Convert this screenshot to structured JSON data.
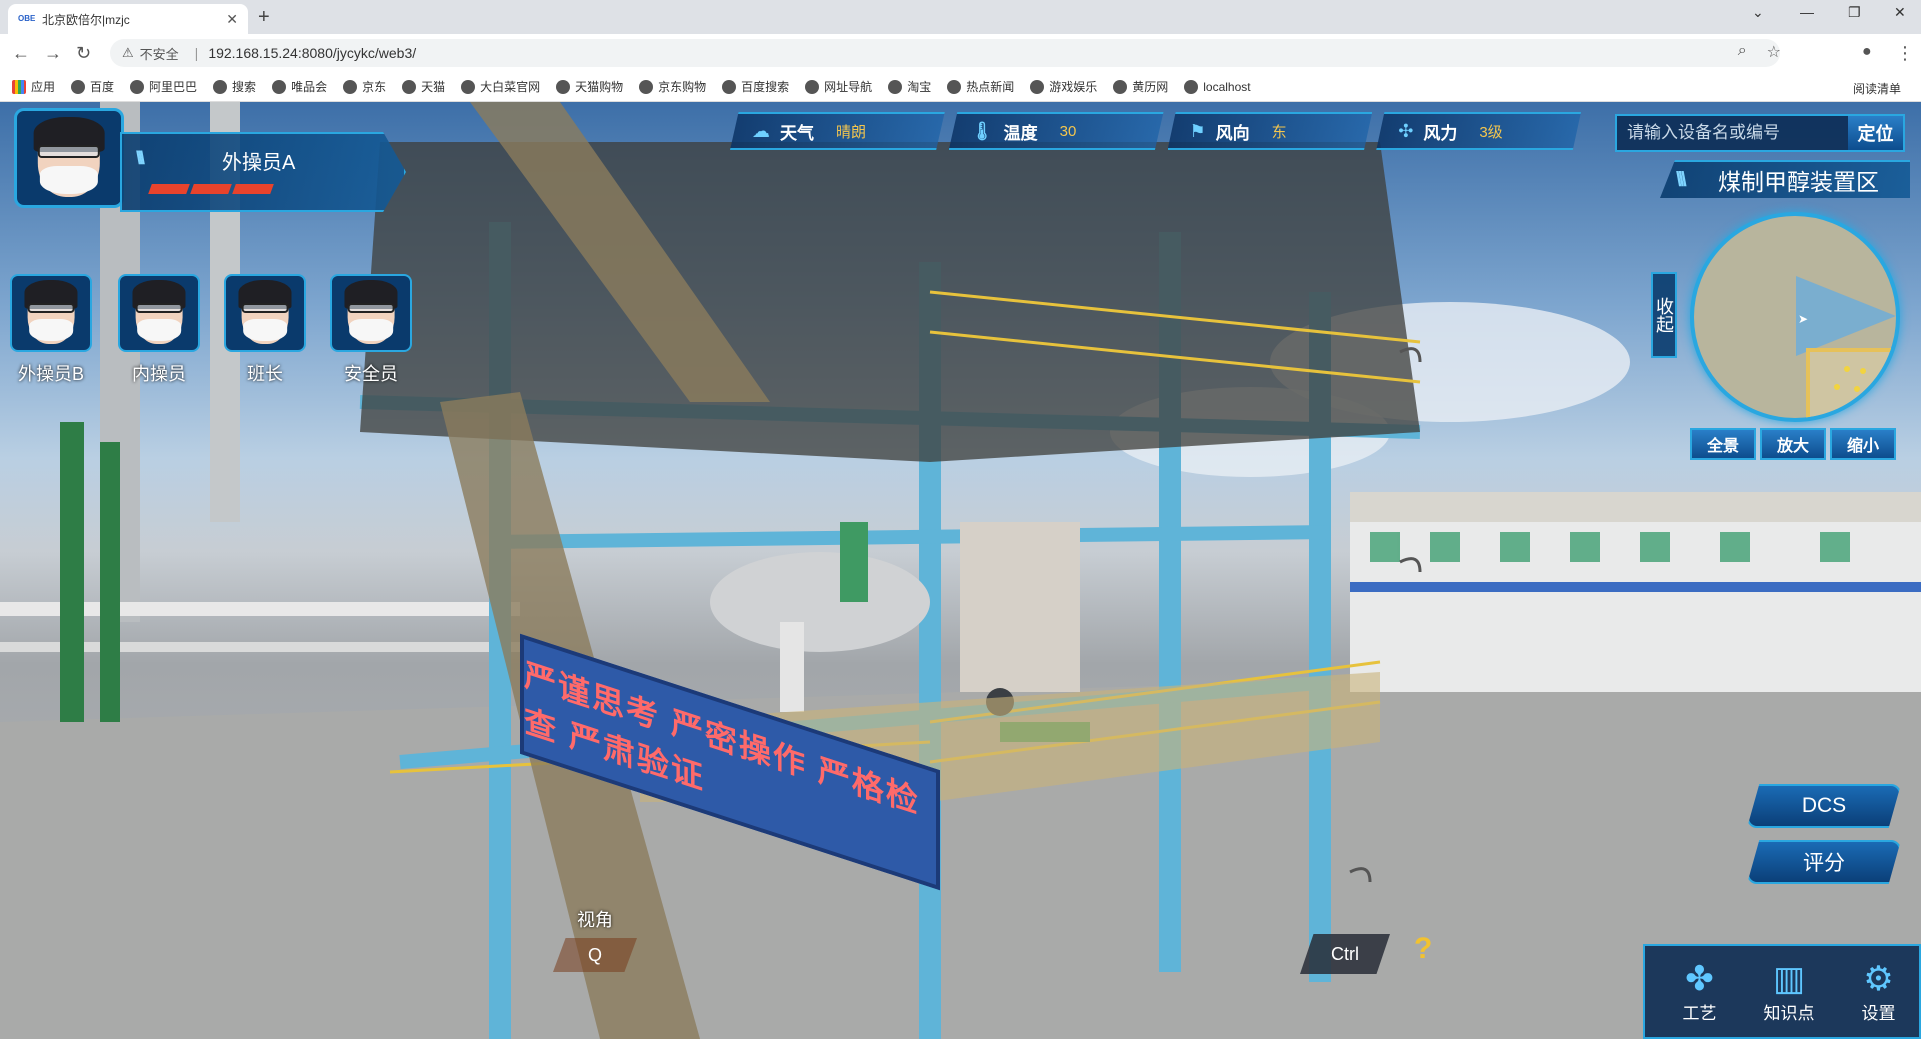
{
  "browser": {
    "tab_title": "北京欧倍尔|mzjc",
    "favicon_text": "OBE",
    "address_warning": "不安全",
    "url": "192.168.15.24:8080/jycykc/web3/",
    "bookmarks": [
      "应用",
      "百度",
      "阿里巴巴",
      "搜索",
      "唯品会",
      "京东",
      "天猫",
      "大白菜官网",
      "天猫购物",
      "京东购物",
      "百度搜索",
      "网址导航",
      "淘宝",
      "热点新闻",
      "游戏娱乐",
      "黄历网",
      "localhost"
    ],
    "reading_list": "阅读清单"
  },
  "hud": {
    "main_role": "外操员A",
    "roles": [
      "外操员B",
      "内操员",
      "班长",
      "安全员"
    ],
    "weather": [
      {
        "label": "天气",
        "value": "晴朗",
        "icon": "cloud-icon"
      },
      {
        "label": "温度",
        "value": "30",
        "icon": "thermometer-icon"
      },
      {
        "label": "风向",
        "value": "东",
        "icon": "flag-icon"
      },
      {
        "label": "风力",
        "value": "3级",
        "icon": "wind-icon"
      }
    ],
    "search_placeholder": "请输入设备名或编号",
    "search_button": "定位",
    "area_title": "煤制甲醇装置区",
    "collapse_label": "收起",
    "map_buttons": [
      "全景",
      "放大",
      "缩小"
    ],
    "side_buttons": [
      "DCS",
      "评分"
    ],
    "toolbar": [
      {
        "label": "工艺",
        "icon": "fan-icon"
      },
      {
        "label": "知识点",
        "icon": "book-icon"
      },
      {
        "label": "设置",
        "icon": "gear-icon"
      }
    ],
    "view_label": "视角",
    "view_key": "Q",
    "ctrl_key": "Ctrl",
    "help_icon": "?",
    "banner_text": "严谨思考 严密操作 严格检查 严肃验证"
  }
}
